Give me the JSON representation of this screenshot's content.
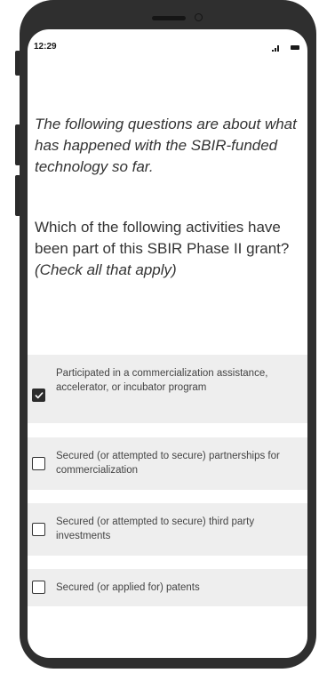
{
  "status_bar": {
    "time": "12:29"
  },
  "survey": {
    "intro_text": "The following questions are about what has happened with the SBIR-funded technology so far.",
    "question_text": "Which of the following activities have been part of this SBIR Phase II grant? ",
    "question_hint": "(Check all that apply)",
    "options": [
      {
        "label": "Participated in a commercialization assistance, accelerator, or incubator program",
        "checked": true
      },
      {
        "label": "Secured (or attempted to secure) partnerships for commercialization",
        "checked": false
      },
      {
        "label": "Secured (or attempted to secure) third party investments",
        "checked": false
      },
      {
        "label": "Secured (or applied for) patents",
        "checked": false
      }
    ]
  },
  "icons": {
    "signal": "signal-icon",
    "battery": "battery-icon",
    "check": "check-icon"
  },
  "colors": {
    "phone_frame": "#2f2f2f",
    "option_background": "#eeeeee",
    "text": "#333333",
    "checked_fill": "#2c2c2c"
  }
}
